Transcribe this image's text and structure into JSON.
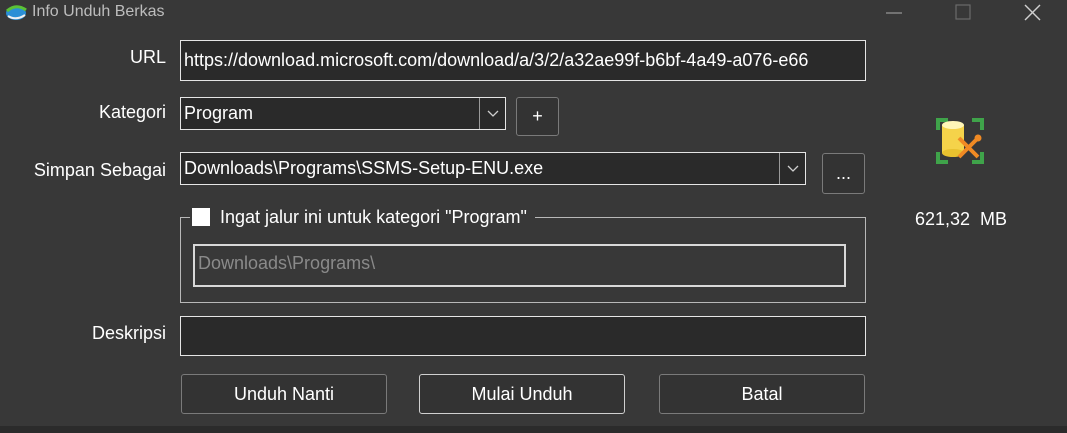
{
  "window": {
    "title": "Info Unduh Berkas"
  },
  "url": {
    "label": "URL",
    "value": "https://download.microsoft.com/download/a/3/2/a32ae99f-b6bf-4a49-a076-e66"
  },
  "category": {
    "label": "Kategori",
    "value": "Program",
    "add_label": "+"
  },
  "save_as": {
    "label": "Simpan Sebagai",
    "value": "Downloads\\Programs\\SSMS-Setup-ENU.exe",
    "browse_label": "..."
  },
  "remember": {
    "checked": false,
    "label": "Ingat jalur ini untuk kategori \"Program\"",
    "path_value": "Downloads\\Programs\\"
  },
  "description": {
    "label": "Deskripsi",
    "value": ""
  },
  "file": {
    "size": "621,32  MB",
    "icon": "file-tools-icon"
  },
  "buttons": {
    "later": "Unduh Nanti",
    "start": "Mulai Unduh",
    "cancel": "Batal"
  },
  "colors": {
    "background": "#383838",
    "field_bg": "#2a2a2a",
    "icon_yellow": "#f5d34a",
    "icon_orange": "#f08a24",
    "icon_green": "#3fa34a"
  }
}
